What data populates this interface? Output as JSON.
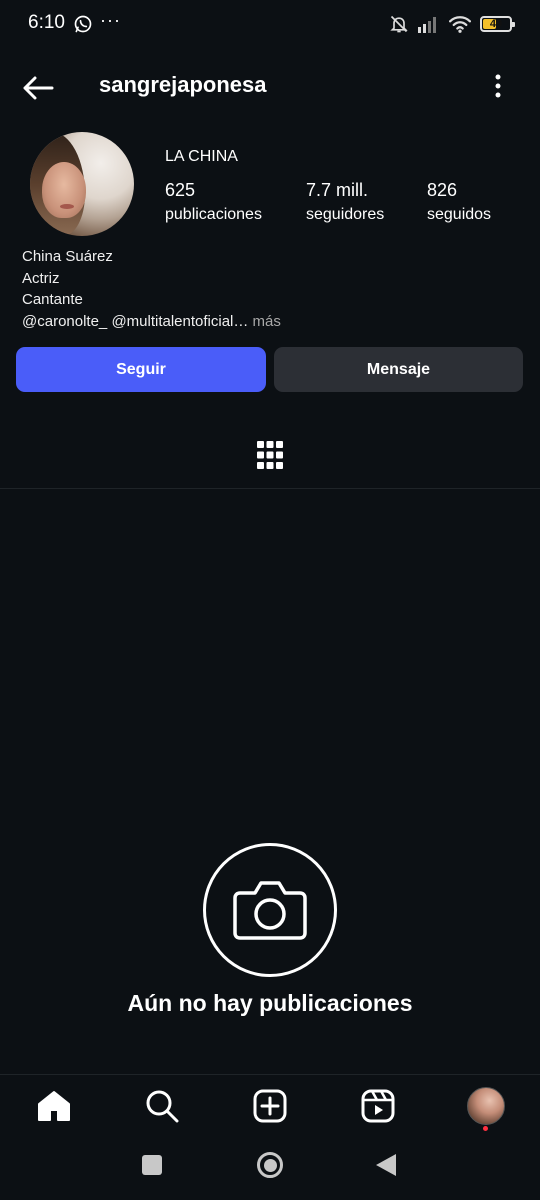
{
  "status_bar": {
    "time": "6:10",
    "dots": "···",
    "battery": "49",
    "battery_color": "#f4c02a"
  },
  "header": {
    "username": "sangrejaponesa",
    "back_icon": "arrow-left-icon",
    "more_icon": "vertical-dots-icon"
  },
  "profile": {
    "display_name": "LA CHINA",
    "stats": {
      "posts_value": "625",
      "posts_label": "publicaciones",
      "followers_value": "7.7 mill.",
      "followers_label": "seguidores",
      "following_value": "826",
      "following_label": "seguidos"
    },
    "bio": {
      "line1": "China Suárez",
      "line2": "Actriz",
      "line3": "Cantante",
      "mentions": "@caronolte_ @multitalentoficial…",
      "more": " más"
    }
  },
  "buttons": {
    "follow": "Seguir",
    "message": "Mensaje",
    "follow_color": "#4a5df9",
    "message_color": "#2c2f35"
  },
  "tabs": {
    "grid_icon": "grid-icon"
  },
  "empty_state": {
    "icon": "camera-icon",
    "text": "Aún no hay publicaciones"
  },
  "bottom_nav": {
    "items": [
      "home-icon",
      "search-icon",
      "create-icon",
      "reels-icon",
      "profile-avatar"
    ]
  },
  "colors": {
    "background": "#0c1014",
    "notification_dot": "#ff3040"
  }
}
